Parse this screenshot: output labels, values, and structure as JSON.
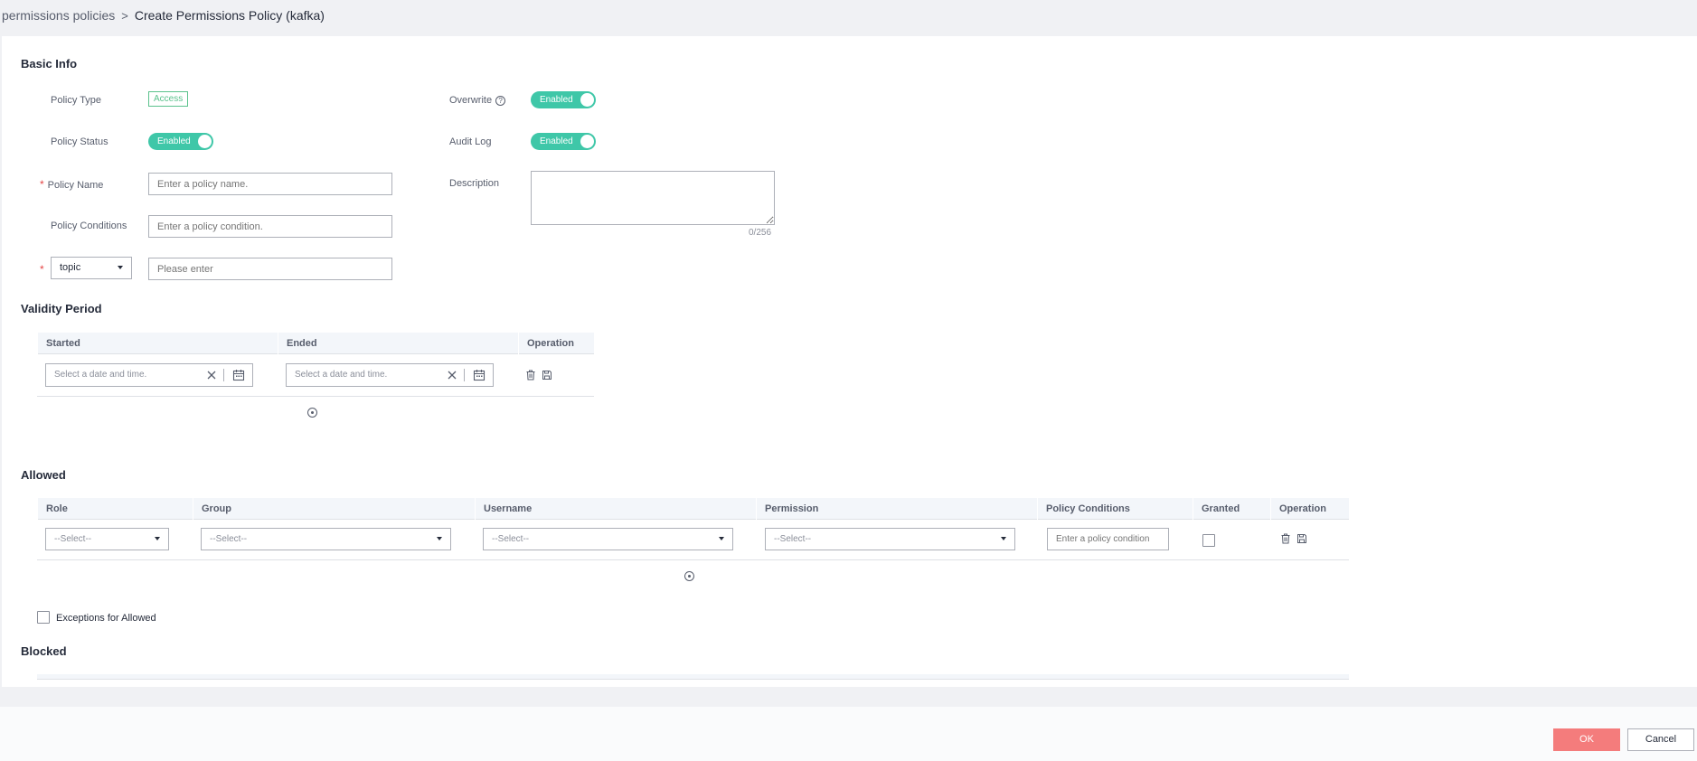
{
  "breadcrumb": {
    "parent": "permissions policies",
    "separator": ">",
    "current": "Create Permissions Policy  (kafka)"
  },
  "basic_info": {
    "title": "Basic Info",
    "policy_type_label": "Policy Type",
    "policy_type_value": "Access",
    "overwrite_label": "Overwrite",
    "overwrite_state": "Enabled",
    "policy_status_label": "Policy Status",
    "policy_status_state": "Enabled",
    "audit_log_label": "Audit Log",
    "audit_log_state": "Enabled",
    "required_mark": "*",
    "policy_name_label": "Policy Name",
    "policy_name_placeholder": "Enter a policy name.",
    "description_label": "Description",
    "description_counter": "0/256",
    "policy_conditions_label": "Policy Conditions",
    "policy_conditions_placeholder": "Enter a policy condition.",
    "resource_type_value": "topic",
    "resource_placeholder": "Please enter"
  },
  "validity_period": {
    "title": "Validity Period",
    "columns": [
      "Started",
      "Ended",
      "Operation"
    ],
    "started_placeholder": "Select a date and time.",
    "ended_placeholder": "Select a date and time."
  },
  "allowed": {
    "title": "Allowed",
    "columns": [
      "Role",
      "Group",
      "Username",
      "Permission",
      "Policy Conditions",
      "Granted",
      "Operation"
    ],
    "select_placeholder": "--Select--",
    "condition_placeholder": "Enter a policy condition",
    "exceptions_label": "Exceptions for Allowed"
  },
  "blocked": {
    "title": "Blocked"
  },
  "footer": {
    "ok_label": "OK",
    "cancel_label": "Cancel"
  },
  "colors": {
    "accent_toggle": "#3fc7a8",
    "ok_button": "#f47c7c",
    "access_tag": "#5bc28c",
    "required": "#e54545"
  },
  "icons": [
    "help-icon",
    "chevron-down-icon",
    "clear-icon",
    "calendar-icon",
    "delete-icon",
    "save-icon",
    "add-circle-icon",
    "checkbox-icon"
  ]
}
